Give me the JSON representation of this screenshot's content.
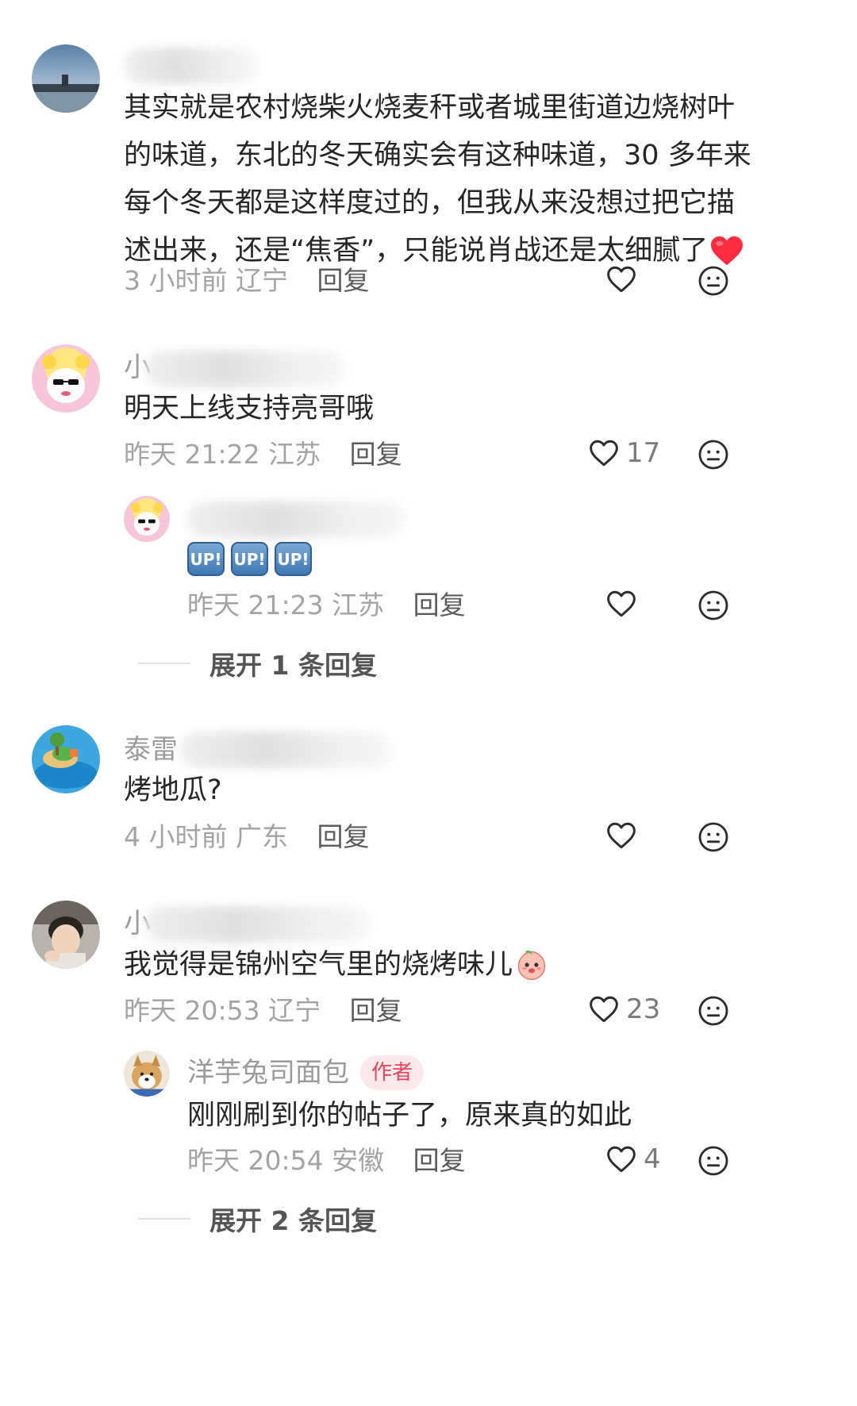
{
  "comments": [
    {
      "text_lines": [
        "其实就是农村烧柴火烧麦秆或者城里街道边烧树叶",
        "的味道，东北的冬天确实会有这种味道，30 多年来",
        "每个冬天都是这样度过的，但我从来没想过把它描",
        "述出来，还是“焦香”，只能说肖战还是太细腻了"
      ],
      "emoji": "red-heart",
      "time": "3 小时前",
      "location": "辽宁",
      "reply_label": "回复",
      "likes": ""
    },
    {
      "username_partial": "小",
      "text": "明天上线支持亮哥哦",
      "time": "昨天 21:22",
      "location": "江苏",
      "reply_label": "回复",
      "likes": "17",
      "replies": [
        {
          "badges": [
            "UP!",
            "UP!",
            "UP!"
          ],
          "time": "昨天 21:23",
          "location": "江苏",
          "reply_label": "回复",
          "likes": ""
        }
      ],
      "expand_label": "展开 1 条回复"
    },
    {
      "username_partial": "泰雷",
      "text": "烤地瓜?",
      "time": "4 小时前",
      "location": "广东",
      "reply_label": "回复",
      "likes": ""
    },
    {
      "username_partial": "小",
      "text": "我觉得是锦州空气里的烧烤味儿",
      "emoji": "peach-face",
      "time": "昨天 20:53",
      "location": "辽宁",
      "reply_label": "回复",
      "likes": "23",
      "replies": [
        {
          "username": "洋芋兔司面包",
          "tag": "作者",
          "text": "刚刚刷到你的帖子了，原来真的如此",
          "time": "昨天 20:54",
          "location": "安徽",
          "reply_label": "回复",
          "likes": "4"
        }
      ],
      "expand_label": "展开 2 条回复"
    }
  ],
  "colors": {
    "author_tag_bg": "#fde8ec",
    "author_tag_text": "#e8455c",
    "heart_emoji": "#ff2d3f"
  }
}
